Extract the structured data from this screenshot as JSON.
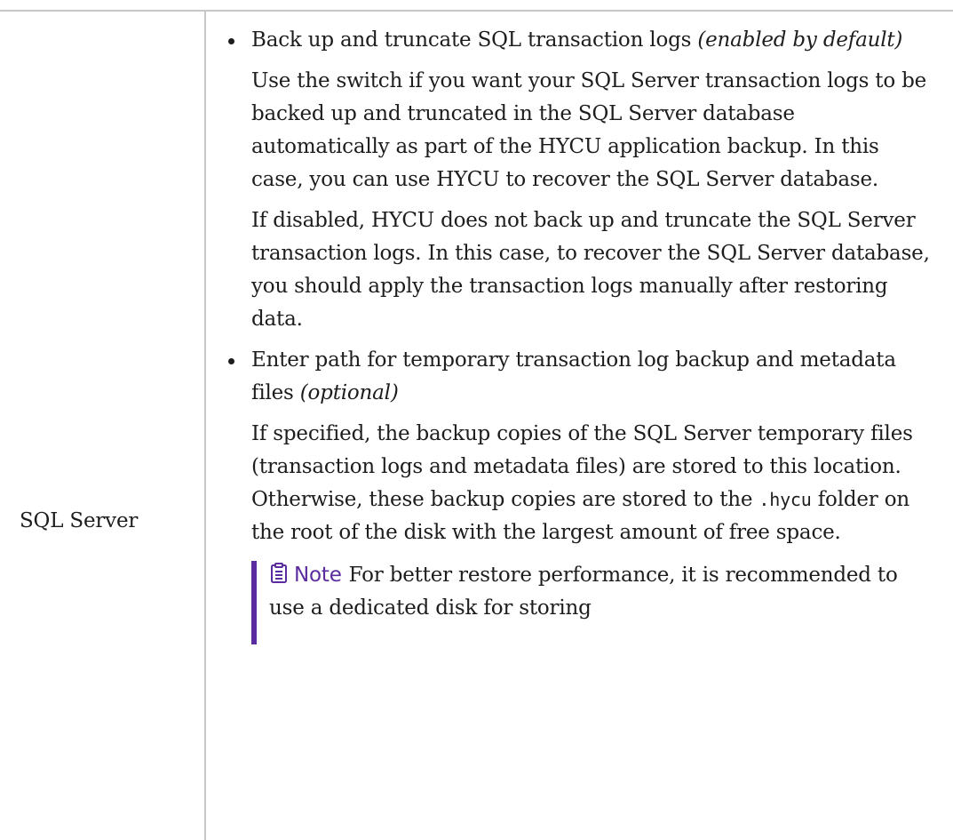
{
  "row": {
    "label": "SQL Server",
    "items": [
      {
        "head": "Back up and truncate SQL transaction logs",
        "head_note": "(enabled by default)",
        "paragraphs": [
          "Use the switch if you want your SQL Server transaction logs to be backed up and truncated in the SQL Server database automatically as part of the HYCU application backup. In this case, you can use HYCU to recover the SQL Server database.",
          "If disabled, HYCU does not back up and truncate the SQL Server transaction logs. In this case, to recover the SQL Server database, you should apply the transaction logs manually after restoring data."
        ]
      },
      {
        "head": "Enter path for temporary transaction log backup and metadata files",
        "head_note": "(optional)",
        "paragraph_before_code": "If specified, the backup copies of the SQL Server temporary files (transaction logs and metadata files) are stored to this location. Otherwise, these backup copies are stored to the",
        "code": ".hycu",
        "paragraph_after_code": "folder on the root of the disk with the largest amount of free space."
      }
    ],
    "note": {
      "label": "Note",
      "text": "For better restore performance, it is recommended to use a dedicated disk for storing"
    }
  },
  "colors": {
    "accent": "#5b2c9f",
    "border": "#c8c8c8",
    "text": "#1d1d1d"
  },
  "icons": {
    "note": "clipboard-note-icon"
  }
}
